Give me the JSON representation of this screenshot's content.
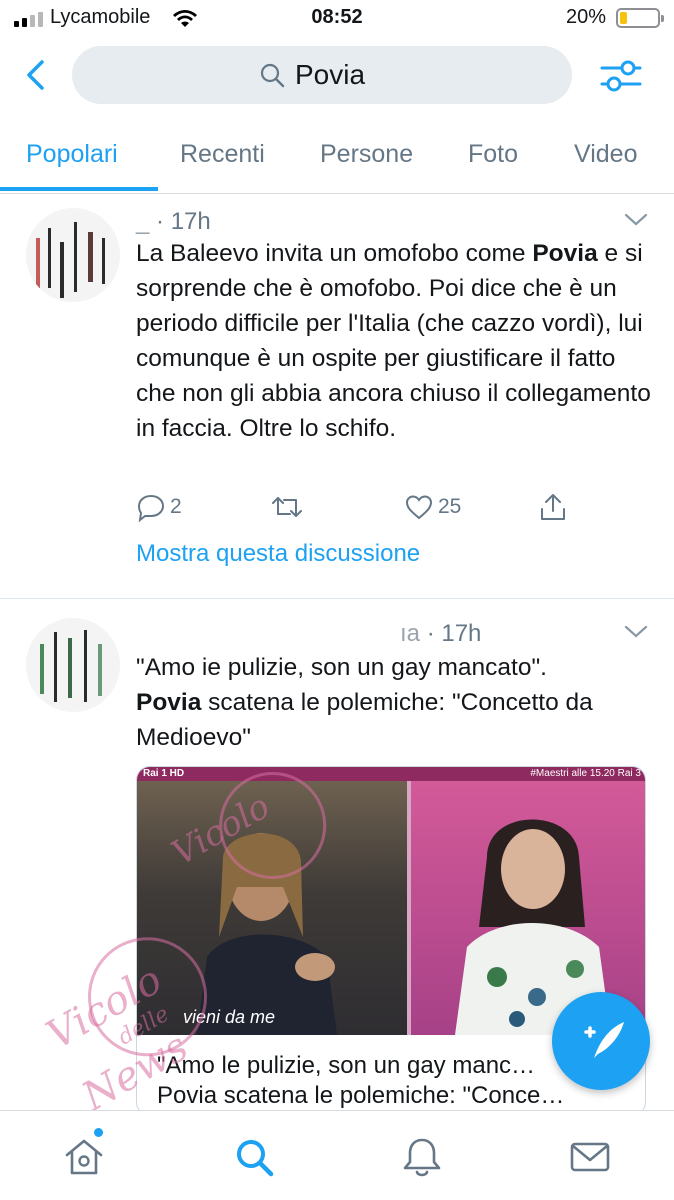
{
  "status_bar": {
    "carrier": "Lycamobile",
    "time": "08:52",
    "battery": "20%",
    "battery_level": 0.2,
    "battery_color": "#f7c20b"
  },
  "search": {
    "query": "Povia",
    "back_icon": "chevron-left-icon",
    "filter_icon": "sliders-icon"
  },
  "tabs": [
    {
      "label": "Popolari",
      "active": true
    },
    {
      "label": "Recenti",
      "active": false
    },
    {
      "label": "Persone",
      "active": false
    },
    {
      "label": "Foto",
      "active": false
    },
    {
      "label": "Video",
      "active": false
    }
  ],
  "tweets": [
    {
      "handle": "_",
      "time": "· 17h",
      "text_before": "La Baleevo invita un omofobo come ",
      "highlight": "Povia",
      "text_after": " e si sorprende che è omofobo. Poi dice che è un periodo difficile per l'Italia (che cazzo vordì), lui comunque è un ospite per giustificare il fatto che non gli abbia ancora chiuso il collegamento in faccia. Oltre lo schifo.",
      "replies": "2",
      "likes": "25",
      "thread_link": "Mostra questa discussione"
    },
    {
      "handle": "ıa",
      "time": "· 17h",
      "text_before": "\"Amo ie pulizie, son un gay mancato\".",
      "highlight": "Povia",
      "text_after": " scatena le polemiche: \"Concetto da Medioevo\"",
      "card": {
        "channel": "Rai 1 HD",
        "tag": "#Maestri alle 15.20 Rai 3",
        "show": "vieni da me",
        "title_line1": "\"Amo le pulizie, son un gay manc…",
        "title_line2": "Povia scatena le polemiche: \"Conce…"
      }
    }
  ],
  "watermark": {
    "line1": "Vicolo",
    "line2": "delle",
    "line3": "News",
    "color": "#d76ea0"
  },
  "accent_color": "#1da1f2",
  "bottom_nav": [
    "home-icon",
    "search-icon",
    "bell-icon",
    "mail-icon"
  ]
}
